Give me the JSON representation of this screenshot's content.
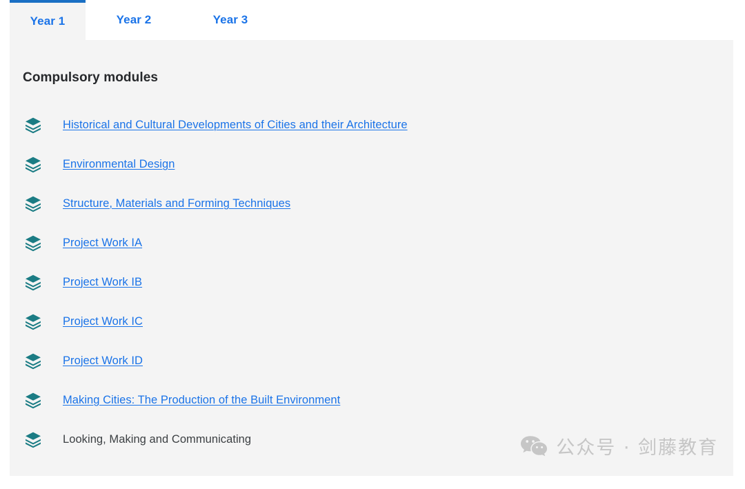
{
  "tabs": [
    {
      "label": "Year 1",
      "active": true
    },
    {
      "label": "Year 2",
      "active": false
    },
    {
      "label": "Year 3",
      "active": false
    }
  ],
  "panel": {
    "title": "Compulsory modules",
    "modules": [
      {
        "label": "Historical and Cultural Developments of Cities and their Architecture",
        "is_link": true,
        "icon": "layers-icon"
      },
      {
        "label": "Environmental Design",
        "is_link": true,
        "icon": "layers-icon"
      },
      {
        "label": "Structure, Materials and Forming Techniques",
        "is_link": true,
        "icon": "layers-icon"
      },
      {
        "label": "Project Work IA",
        "is_link": true,
        "icon": "layers-icon"
      },
      {
        "label": "Project Work IB",
        "is_link": true,
        "icon": "layers-icon"
      },
      {
        "label": "Project Work IC",
        "is_link": true,
        "icon": "layers-icon"
      },
      {
        "label": "Project Work ID",
        "is_link": true,
        "icon": "layers-icon"
      },
      {
        "label": "Making Cities: The Production of the Built Environment",
        "is_link": true,
        "icon": "layers-icon"
      },
      {
        "label": "Looking, Making and Communicating",
        "is_link": false,
        "icon": "layers-icon"
      }
    ]
  },
  "watermark": {
    "icon": "wechat-icon",
    "text": "公众号 · 剑藤教育"
  },
  "colors": {
    "link": "#1a73e8",
    "tab_active_border": "#1a6fc4",
    "panel_background": "#f4f4f4",
    "icon_teal": "#1b7c84",
    "heading": "#26282b",
    "plain_text": "#3c4043",
    "watermark": "#c6c6c6"
  }
}
